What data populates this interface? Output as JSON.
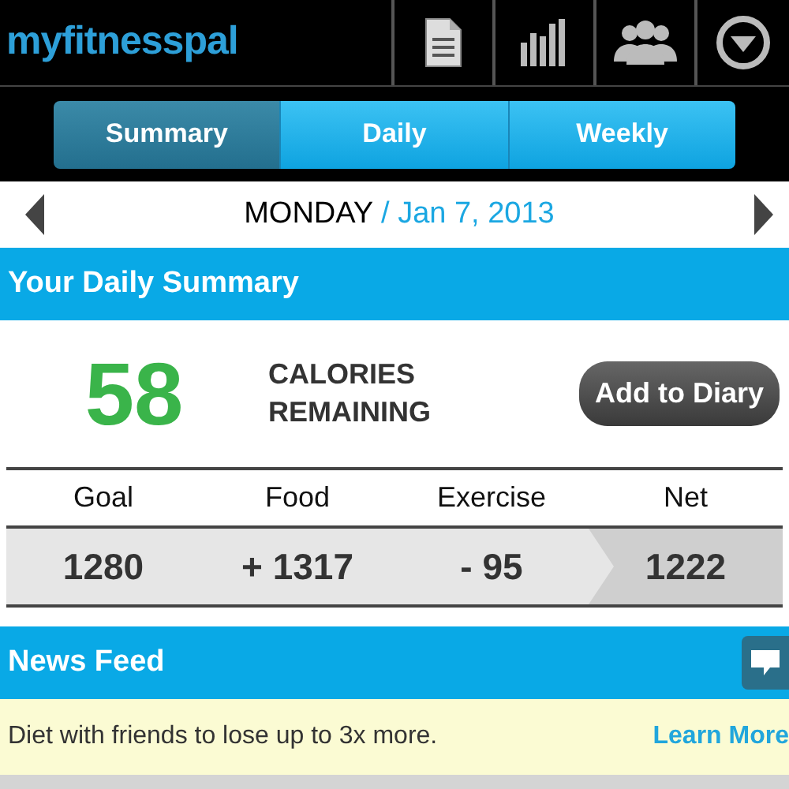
{
  "app_bar": {
    "logo": "myfitnesspal"
  },
  "tabs": [
    {
      "label": "Summary",
      "selected": true
    },
    {
      "label": "Daily",
      "selected": false
    },
    {
      "label": "Weekly",
      "selected": false
    }
  ],
  "date_nav": {
    "day": "MONDAY",
    "separator": "/",
    "date": "Jan 7, 2013"
  },
  "daily_summary": {
    "title": "Your Daily Summary",
    "calories": "58",
    "calories_label": "CALORIES REMAINING",
    "button": "Add to Diary",
    "columns": [
      {
        "label": "Goal",
        "value": "1280",
        "highlighted": false
      },
      {
        "label": "Food",
        "value": "+ 1317",
        "highlighted": false
      },
      {
        "label": "Exercise",
        "value": "- 95",
        "highlighted": false
      },
      {
        "label": "Net",
        "value": "1222",
        "highlighted": true
      }
    ]
  },
  "news_feed": {
    "title": "News Feed",
    "banner_text": "Diet with friends to lose up to 3x more.",
    "banner_link": "Learn More"
  }
}
